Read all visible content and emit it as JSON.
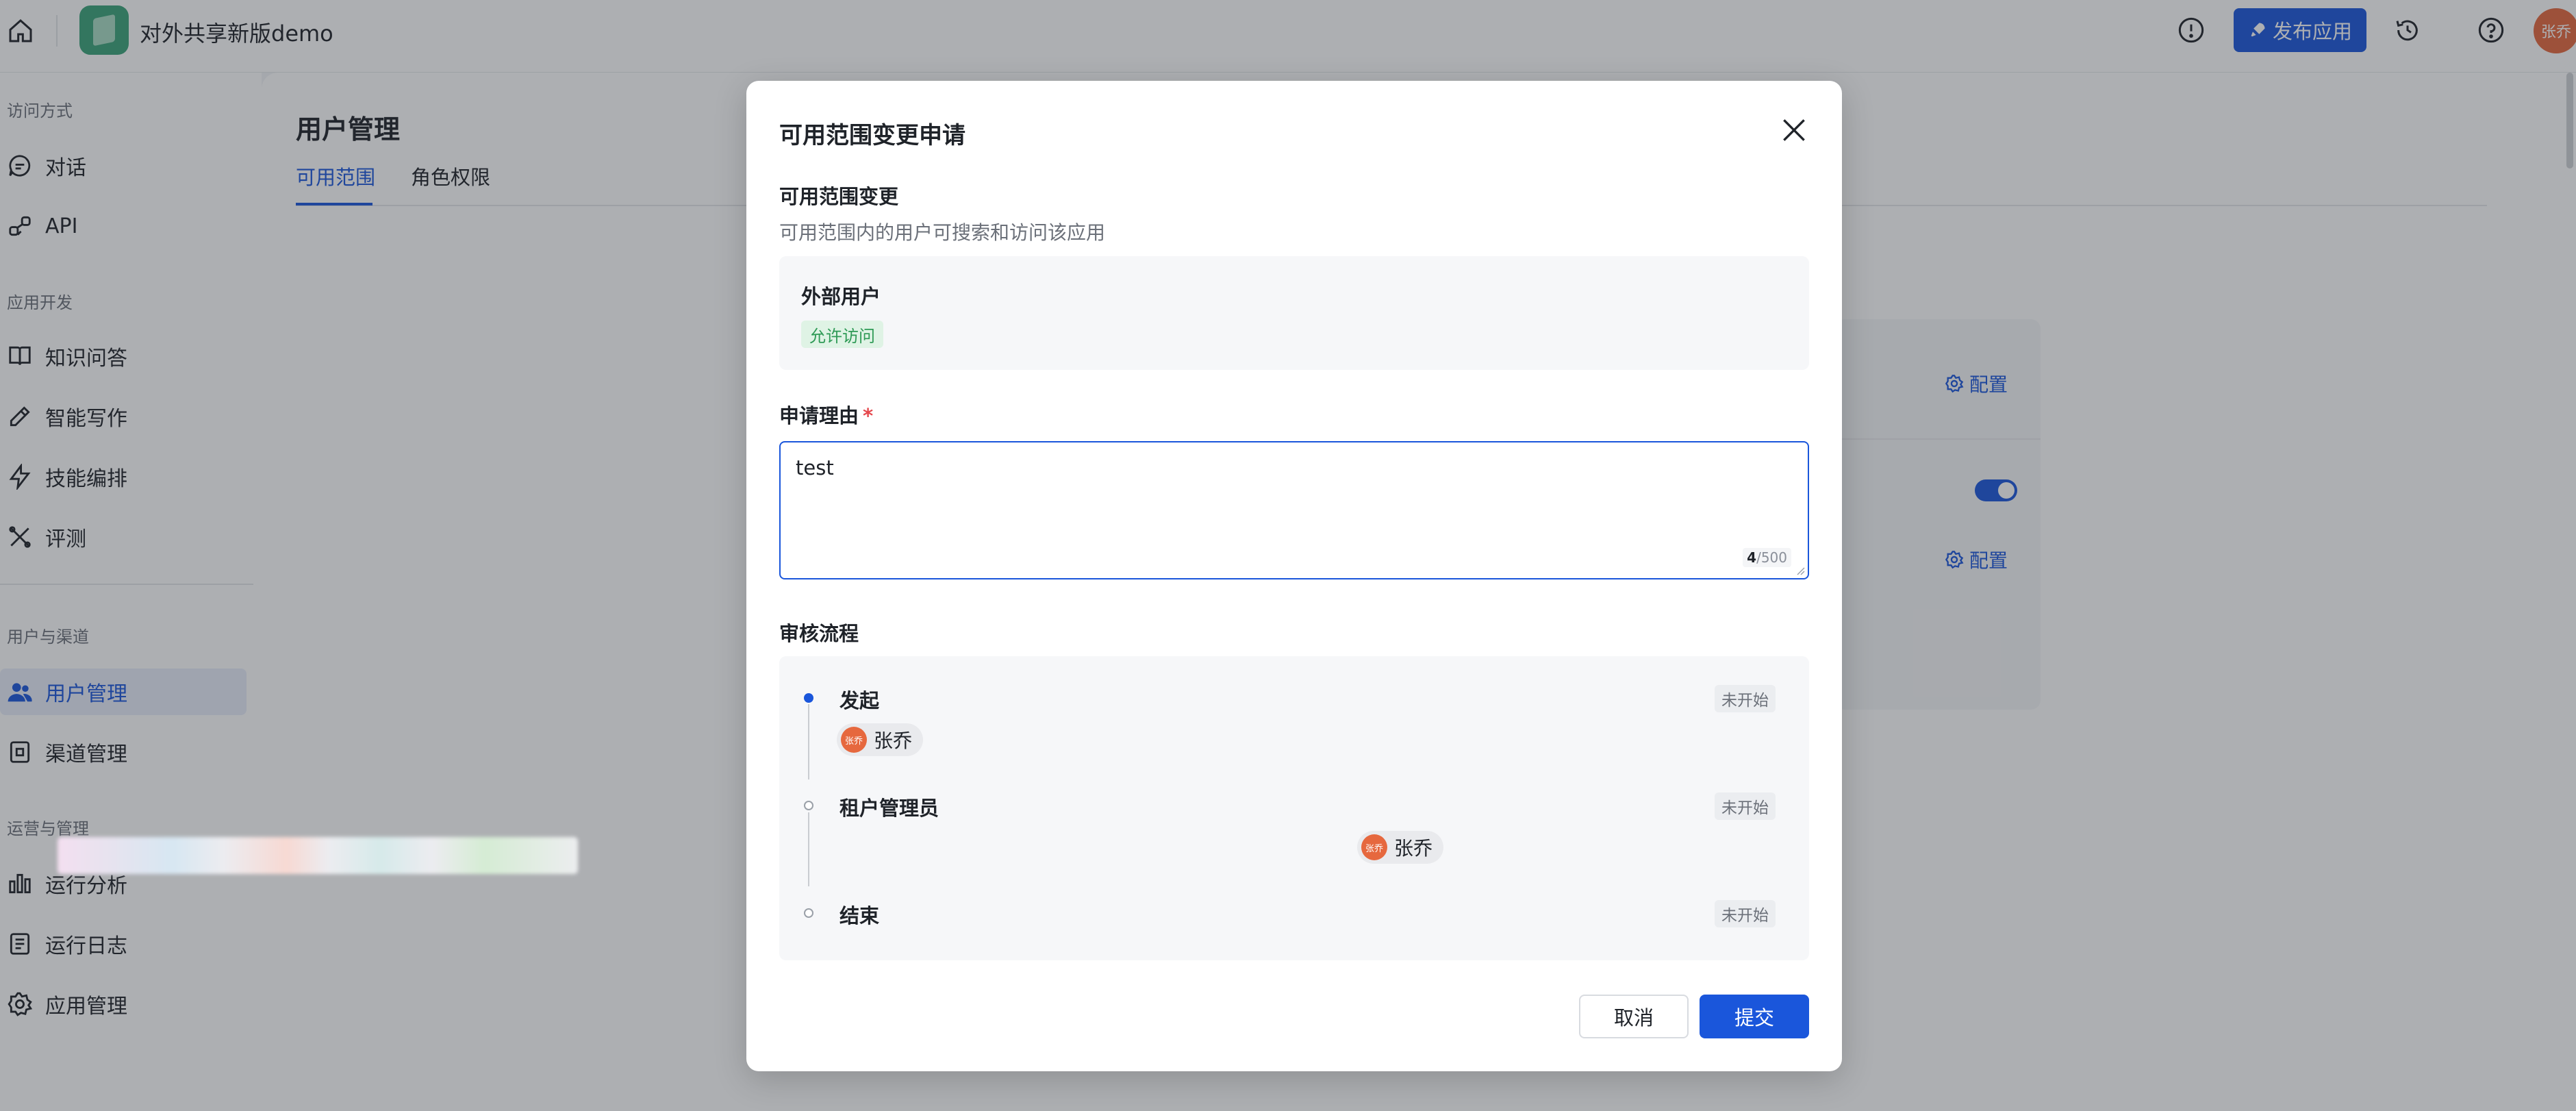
{
  "topbar": {
    "app_name": "对外共享新版demo",
    "publish_label": "发布应用",
    "user_avatar_text": "张乔"
  },
  "sidebar": {
    "groups": [
      {
        "title": "访问方式",
        "items": [
          {
            "label": "对话",
            "icon": "chat-icon"
          },
          {
            "label": "API",
            "icon": "api-icon"
          }
        ]
      },
      {
        "title": "应用开发",
        "items": [
          {
            "label": "知识问答",
            "icon": "book-icon"
          },
          {
            "label": "智能写作",
            "icon": "pen-icon"
          },
          {
            "label": "技能编排",
            "icon": "bolt-icon"
          },
          {
            "label": "评测",
            "icon": "tools-icon"
          }
        ]
      },
      {
        "title": "用户与渠道",
        "items": [
          {
            "label": "用户管理",
            "icon": "users-icon",
            "active": true
          },
          {
            "label": "渠道管理",
            "icon": "channel-icon"
          }
        ]
      },
      {
        "title": "运营与管理",
        "items": [
          {
            "label": "运行分析",
            "icon": "bar-chart-icon"
          },
          {
            "label": "运行日志",
            "icon": "log-icon"
          },
          {
            "label": "应用管理",
            "icon": "gear-icon"
          }
        ]
      }
    ]
  },
  "main": {
    "title": "用户管理",
    "tabs": [
      {
        "label": "可用范围",
        "active": true
      },
      {
        "label": "角色权限"
      }
    ],
    "config_label": "配置"
  },
  "modal": {
    "title": "可用范围变更申请",
    "scope_section": {
      "title": "可用范围变更",
      "description": "可用范围内的用户可搜索和访问该应用",
      "target": "外部用户",
      "tag": "允许访问"
    },
    "reason": {
      "label": "申请理由",
      "required_mark": "*",
      "value": "test",
      "count": "4",
      "max": "/500"
    },
    "flow": {
      "title": "审核流程",
      "steps": [
        {
          "name": "发起",
          "status": "未开始",
          "user": "张乔",
          "avatar_text": "张乔"
        },
        {
          "name": "租户管理员",
          "status": "未开始",
          "user": "张乔",
          "avatar_text": "张乔"
        },
        {
          "name": "结束",
          "status": "未开始"
        }
      ]
    },
    "buttons": {
      "cancel": "取消",
      "submit": "提交"
    }
  },
  "colors": {
    "primary": "#1a56db",
    "success_tag_bg": "#dff3e5",
    "avatar": "#e6683e"
  }
}
